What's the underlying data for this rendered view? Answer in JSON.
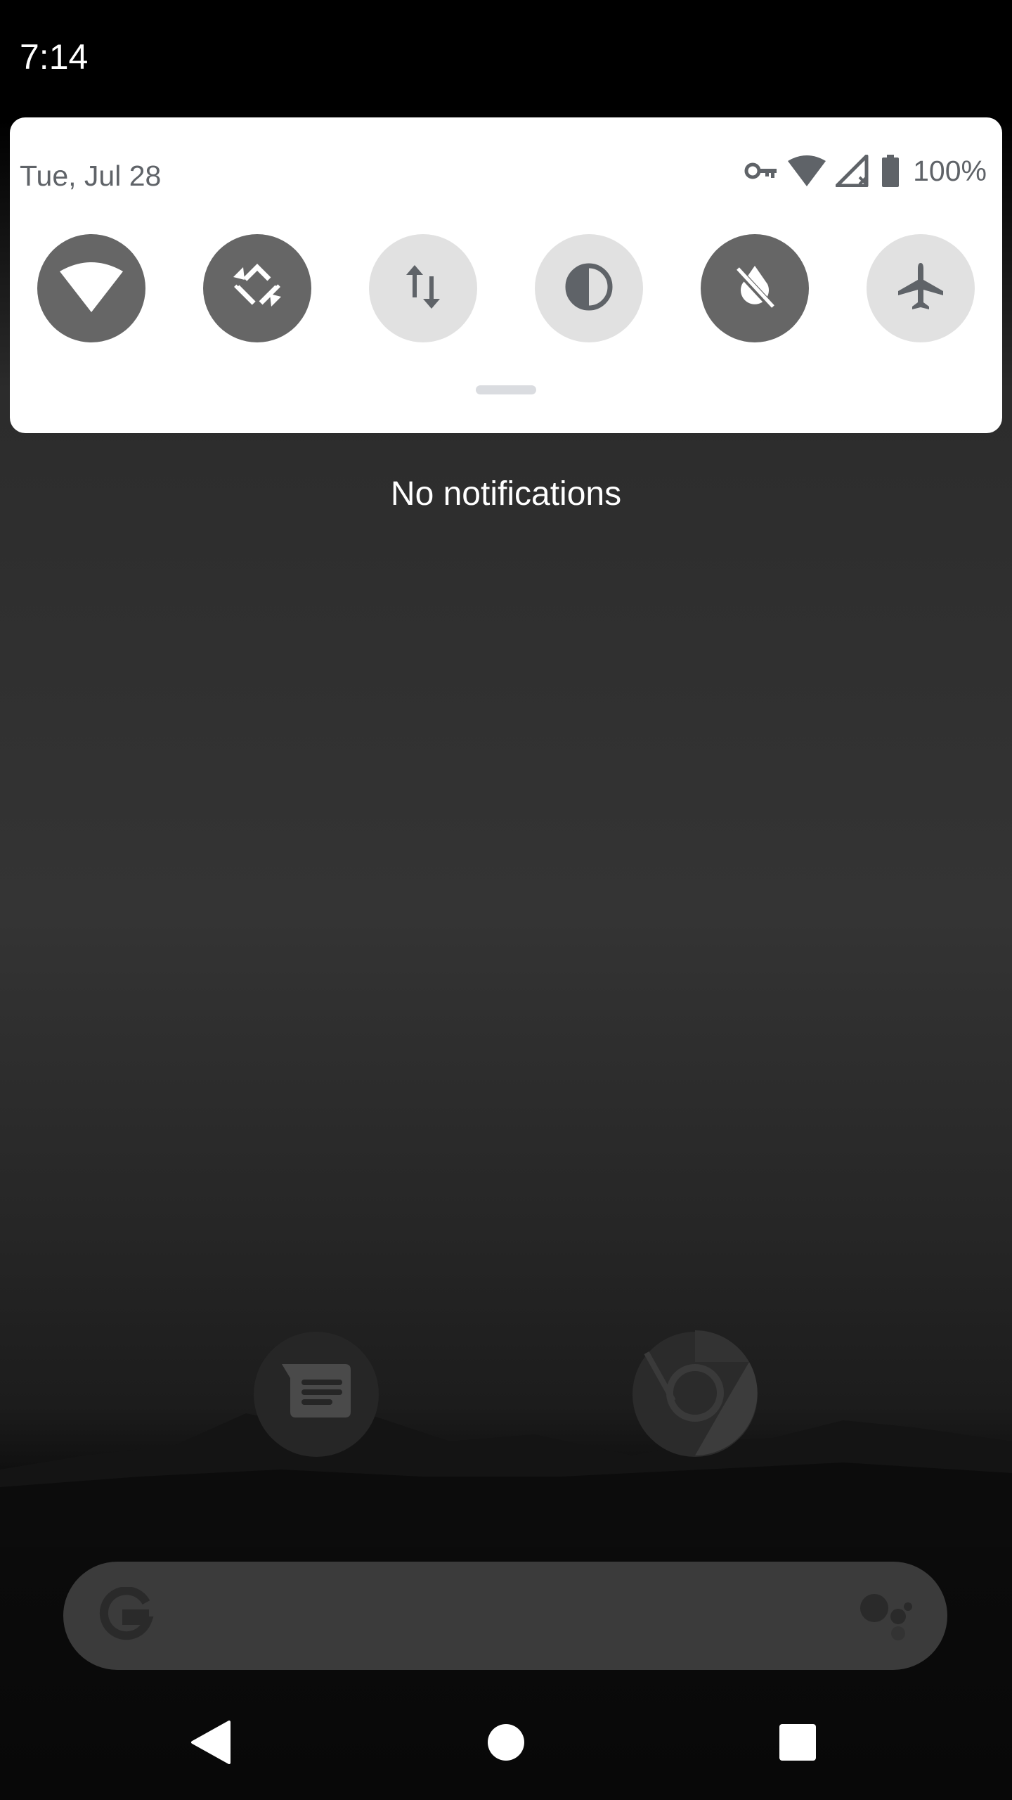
{
  "status_bar": {
    "time": "7:14"
  },
  "quick_settings": {
    "date": "Tue, Jul 28",
    "battery_percent": "100%",
    "status_icons": [
      "vpn-key-icon",
      "wifi-icon",
      "cellular-no-signal-icon",
      "battery-icon"
    ],
    "tiles": [
      {
        "name": "wifi",
        "icon": "wifi-icon",
        "state": "on"
      },
      {
        "name": "auto-rotate",
        "icon": "rotate-icon",
        "state": "on"
      },
      {
        "name": "mobile-data",
        "icon": "data-arrows-icon",
        "state": "off"
      },
      {
        "name": "invert-colors",
        "icon": "half-circle-icon",
        "state": "off"
      },
      {
        "name": "battery-saver",
        "icon": "battery-saver-off-icon",
        "state": "on"
      },
      {
        "name": "airplane-mode",
        "icon": "airplane-icon",
        "state": "off"
      }
    ]
  },
  "notifications": {
    "empty_text": "No notifications"
  },
  "home": {
    "dock_apps": [
      {
        "name": "messages",
        "icon": "messages-icon"
      },
      {
        "name": "chrome",
        "icon": "chrome-icon"
      }
    ],
    "search_bar": {
      "logo": "google-g-icon",
      "assistant": "assistant-icon"
    }
  },
  "nav_bar": {
    "buttons": [
      "back-icon",
      "home-icon",
      "recents-icon"
    ]
  },
  "colors": {
    "panel_bg": "#ffffff",
    "tile_on": "#666666",
    "tile_off": "#e1e1e1",
    "text_secondary": "#5f6368"
  }
}
